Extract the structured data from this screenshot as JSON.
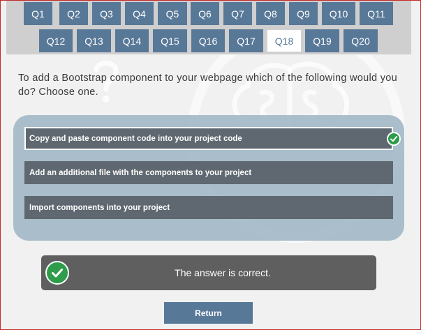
{
  "nav": {
    "row1": [
      "Q1",
      "Q2",
      "Q3",
      "Q4",
      "Q5",
      "Q6",
      "Q7",
      "Q8",
      "Q9",
      "Q10",
      "Q11"
    ],
    "row2": [
      "Q12",
      "Q13",
      "Q14",
      "Q15",
      "Q16",
      "Q17",
      "Q18",
      "Q19",
      "Q20"
    ],
    "active": "Q18"
  },
  "question": {
    "text": "To add a Bootstrap component to your webpage which of the following would you do? Choose one."
  },
  "options": [
    {
      "label": "Copy and paste component code into your project code",
      "selected": true
    },
    {
      "label": "Add an additional file with the components to your project",
      "selected": false
    },
    {
      "label": "Import components into your project",
      "selected": false
    }
  ],
  "result": {
    "text": "The answer is correct.",
    "status_color": "#2e9c4a"
  },
  "footer": {
    "return_label": "Return"
  },
  "theme": {
    "button_color": "#587898",
    "option_color": "#5f6870",
    "panel_color": "#a4b8c8",
    "frame_color": "#c62828"
  },
  "icons": {
    "option_check": "check-circle-icon",
    "result_check": "check-circle-icon"
  }
}
